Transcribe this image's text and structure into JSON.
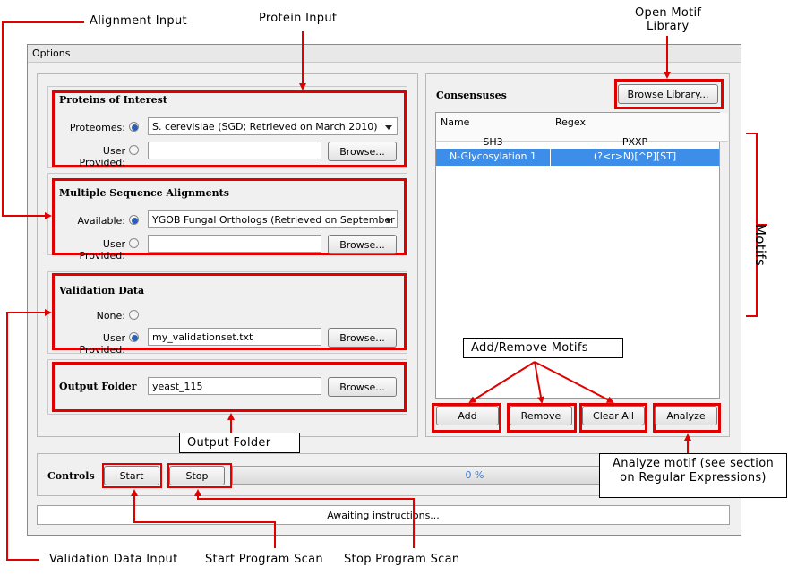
{
  "window": {
    "title": "Options"
  },
  "proteins": {
    "title": "Proteins of Interest",
    "proteomes_label": "Proteomes:",
    "proteomes_value": "S. cerevisiae (SGD; Retrieved on March 2010)",
    "user_label": "User Provided:",
    "user_value": "",
    "browse": "Browse..."
  },
  "alignments": {
    "title": "Multiple Sequence Alignments",
    "available_label": "Available:",
    "available_value": "YGOB Fungal Orthologs (Retrieved on September ...",
    "user_label": "User Provided:",
    "user_value": "",
    "browse": "Browse..."
  },
  "validation": {
    "title": "Validation Data",
    "none_label": "None:",
    "user_label": "User Provided:",
    "user_value": "my_validationset.txt",
    "browse": "Browse..."
  },
  "output": {
    "title": "Output Folder",
    "value": "yeast_115",
    "browse": "Browse..."
  },
  "consensuses": {
    "title": "Consensuses",
    "browse_library": "Browse Library...",
    "columns": [
      "Name",
      "Regex"
    ],
    "rows": [
      {
        "name": "SH3",
        "regex": "PXXP",
        "selected": false
      },
      {
        "name": "N-Glycosylation 1",
        "regex": "(?<r>N)[^P][ST]",
        "selected": true
      }
    ],
    "buttons": {
      "add": "Add",
      "remove": "Remove",
      "clear": "Clear All",
      "analyze": "Analyze"
    }
  },
  "controls": {
    "title": "Controls",
    "start": "Start",
    "stop": "Stop",
    "progress_text": "0 %",
    "progress": 0
  },
  "status": {
    "text": "Awaiting instructions..."
  },
  "annotations": {
    "alignment_input": "Alignment  Input",
    "protein_input": "Protein Input",
    "open_motif_library_1": "Open Motif",
    "open_motif_library_2": "Library",
    "motifs": "Motifs",
    "add_remove": "Add/Remove  Motifs",
    "output_folder": "Output Folder",
    "analyze_motif_1": "Analyze motif (see section",
    "analyze_motif_2": "on Regular  Expressions)",
    "validation_input": "Validation  Data  Input",
    "start_scan": "Start Program  Scan",
    "stop_scan": "Stop Program  Scan"
  },
  "colors": {
    "highlight_red": "#e00000",
    "selection_blue": "#3d8ee8",
    "progress_text": "#3a7bd5"
  }
}
